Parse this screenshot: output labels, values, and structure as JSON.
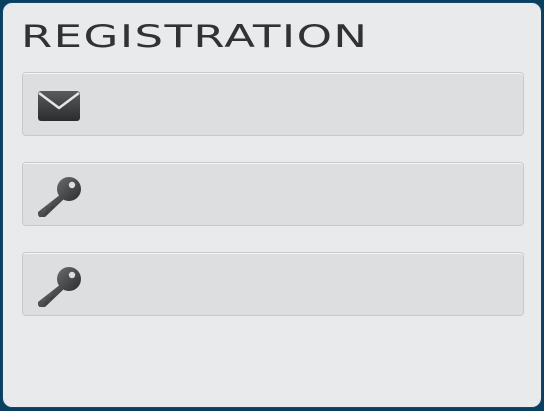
{
  "form": {
    "title": "REGISTRATION",
    "fields": [
      {
        "type": "email",
        "icon": "envelope-icon",
        "value": "",
        "placeholder": ""
      },
      {
        "type": "password",
        "icon": "key-icon",
        "value": "",
        "placeholder": ""
      },
      {
        "type": "password",
        "icon": "key-icon",
        "value": "",
        "placeholder": ""
      }
    ]
  },
  "colors": {
    "frame": "#0b3f61",
    "panel": "#e9eaeb",
    "field": "#dddedf",
    "icon": "#3a3b3c"
  }
}
